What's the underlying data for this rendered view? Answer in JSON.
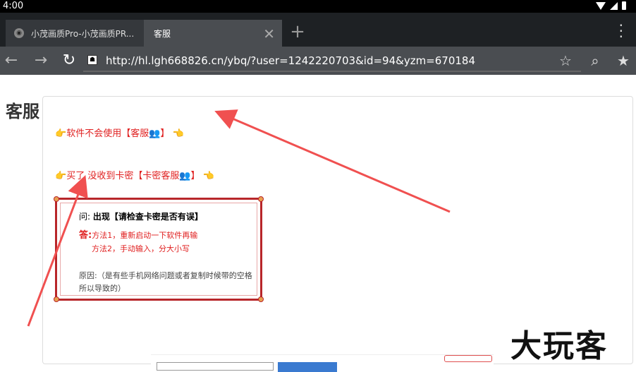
{
  "status": {
    "time": "4:00"
  },
  "tabs": [
    {
      "label": "小茂画质Pro-小茂画质PR..."
    },
    {
      "label": "客服"
    }
  ],
  "toolbar": {
    "url": "http://hl.lgh668826.cn/ybq/?user=1242220703&id=94&yzm=670184"
  },
  "page": {
    "title": "客服",
    "line1": {
      "text": "软件不会使用【客服",
      "suffix": "】"
    },
    "line2": {
      "text": "买了 没收到卡密【卡密客服",
      "suffix": "】"
    },
    "notice": {
      "q_prefix": "问:",
      "q_text": "出现【请检查卡密是否有误】",
      "a_prefix": "答:",
      "a_line1": "方法1，重新启动一下软件再输",
      "a_line2": "方法2，手动输入，分大小写",
      "reason": "原因:（是有些手机网络问题或者复制时候带的空格所以导致的）"
    },
    "watermark": "大玩客"
  },
  "colors": {
    "accent": "#e02020",
    "box_border": "#b8262a",
    "arrow": "#f05050"
  }
}
